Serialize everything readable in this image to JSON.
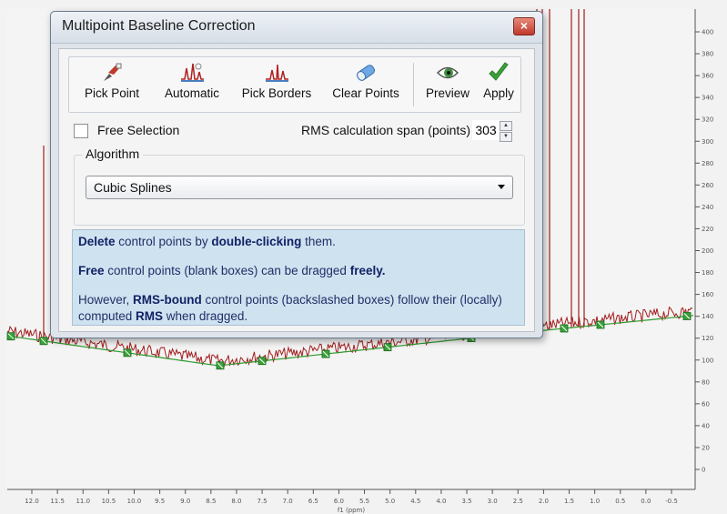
{
  "window": {
    "title": "Multipoint Baseline Correction",
    "close_glyph": "×"
  },
  "toolbar": {
    "buttons": [
      {
        "label": "Pick Point",
        "icon": "pick-point-icon"
      },
      {
        "label": "Automatic",
        "icon": "automatic-icon"
      },
      {
        "label": "Pick Borders",
        "icon": "pick-borders-icon"
      },
      {
        "label": "Clear Points",
        "icon": "eraser-icon"
      },
      {
        "label": "Preview",
        "icon": "eye-icon"
      },
      {
        "label": "Apply",
        "icon": "checkmark-icon"
      }
    ]
  },
  "options": {
    "free_selection_label": "Free Selection",
    "free_selection_checked": false,
    "rms_span_label": "RMS calculation span (points)",
    "rms_span_value": "303"
  },
  "algorithm": {
    "group_title": "Algorithm",
    "selected": "Cubic Splines"
  },
  "info": {
    "line1": {
      "b1": "Delete",
      "t1": " control points by ",
      "b2": "double-clicking",
      "t2": " them."
    },
    "line2": {
      "b1": "Free",
      "t1": " control points (blank boxes) can be dragged ",
      "b2": "freely."
    },
    "line3": {
      "t0": "However, ",
      "b1": "RMS-bound",
      "t1": " control points (backslashed boxes) follow their (locally) computed ",
      "b2": "RMS",
      "t2": " when dragged."
    }
  },
  "spectrum": {
    "x_ticks": [
      "12.0",
      "11.5",
      "11.0",
      "10.5",
      "10.0",
      "9.5",
      "9.0",
      "8.5",
      "8.0",
      "7.5",
      "7.0",
      "6.5",
      "6.0",
      "5.5",
      "5.0",
      "4.5",
      "4.0",
      "3.5",
      "3.0",
      "2.5",
      "2.0",
      "1.5",
      "1.0",
      "0.5",
      "0.0",
      "-0.5"
    ],
    "x_label": "f1 (ppm)",
    "y_ticks": [
      "400",
      "380",
      "360",
      "340",
      "320",
      "300",
      "280",
      "260",
      "240",
      "220",
      "200",
      "180",
      "160",
      "140",
      "120",
      "100",
      "80",
      "60",
      "40",
      "20",
      "0"
    ],
    "colors": {
      "signal": "#a21d1d",
      "baseline": "#2f9a2f",
      "point": "#3aa23a"
    }
  }
}
